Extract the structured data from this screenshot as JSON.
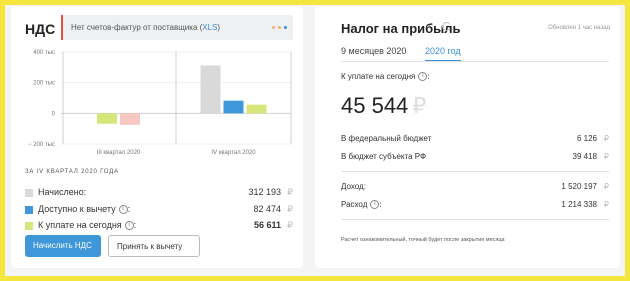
{
  "vat": {
    "title": "НДС",
    "notice_text": "Нет счетов-фактур от поставщика (",
    "notice_link": "XLS",
    "notice_end": ")",
    "period_caption": "ЗА IV КВАРТАЛ 2020 ГОДА",
    "rows": [
      {
        "label": "Начислено:",
        "value": "312 193",
        "color": "#d9d9d9"
      },
      {
        "label": "Доступно к вычету",
        "value": "82 474",
        "color": "#3d97d9"
      },
      {
        "label": "К уплате на сегодня",
        "value": "56 611",
        "color": "#d7e67b"
      }
    ],
    "currency": "₽",
    "btn_calc": "Начислить НДС",
    "btn_accept": "Принять к вычету"
  },
  "chart_data": {
    "type": "bar",
    "categories": [
      "III квартал 2020",
      "IV квартал 2020"
    ],
    "series": [
      {
        "values": [
          0,
          312193
        ],
        "color": "#d9d9d9"
      },
      {
        "values": [
          0,
          82474
        ],
        "color": "#3d97d9"
      },
      {
        "values": [
          -68000,
          56611
        ],
        "color": "#d7e67b"
      },
      {
        "values": [
          -75000,
          0
        ],
        "color": "#f7c7c2"
      }
    ],
    "yticks": [
      400000,
      200000,
      0,
      -200000
    ],
    "ytick_labels": [
      "400 тыс",
      "200 тыс",
      "0",
      "− 200 тыс"
    ],
    "ylim": [
      -200000,
      400000
    ]
  },
  "tax": {
    "title": "Налог на прибыль",
    "updated": "Обновлен 1 час назад",
    "tabs": [
      "9 месяцев 2020",
      "2020 год"
    ],
    "due_label": "К уплате на сегодня",
    "amount": "45 544",
    "federal_label": "В федеральный бюджет",
    "federal_value": "6 126",
    "regional_label": "В бюджет субъекта РФ",
    "regional_value": "39 418",
    "income_label": "Доход:",
    "income_value": "1 520 197",
    "expense_label": "Расход",
    "expense_value": "1 214 338",
    "currency": "₽",
    "footnote": "Расчет ознакомительный, точный будет после закрытия месяца"
  }
}
